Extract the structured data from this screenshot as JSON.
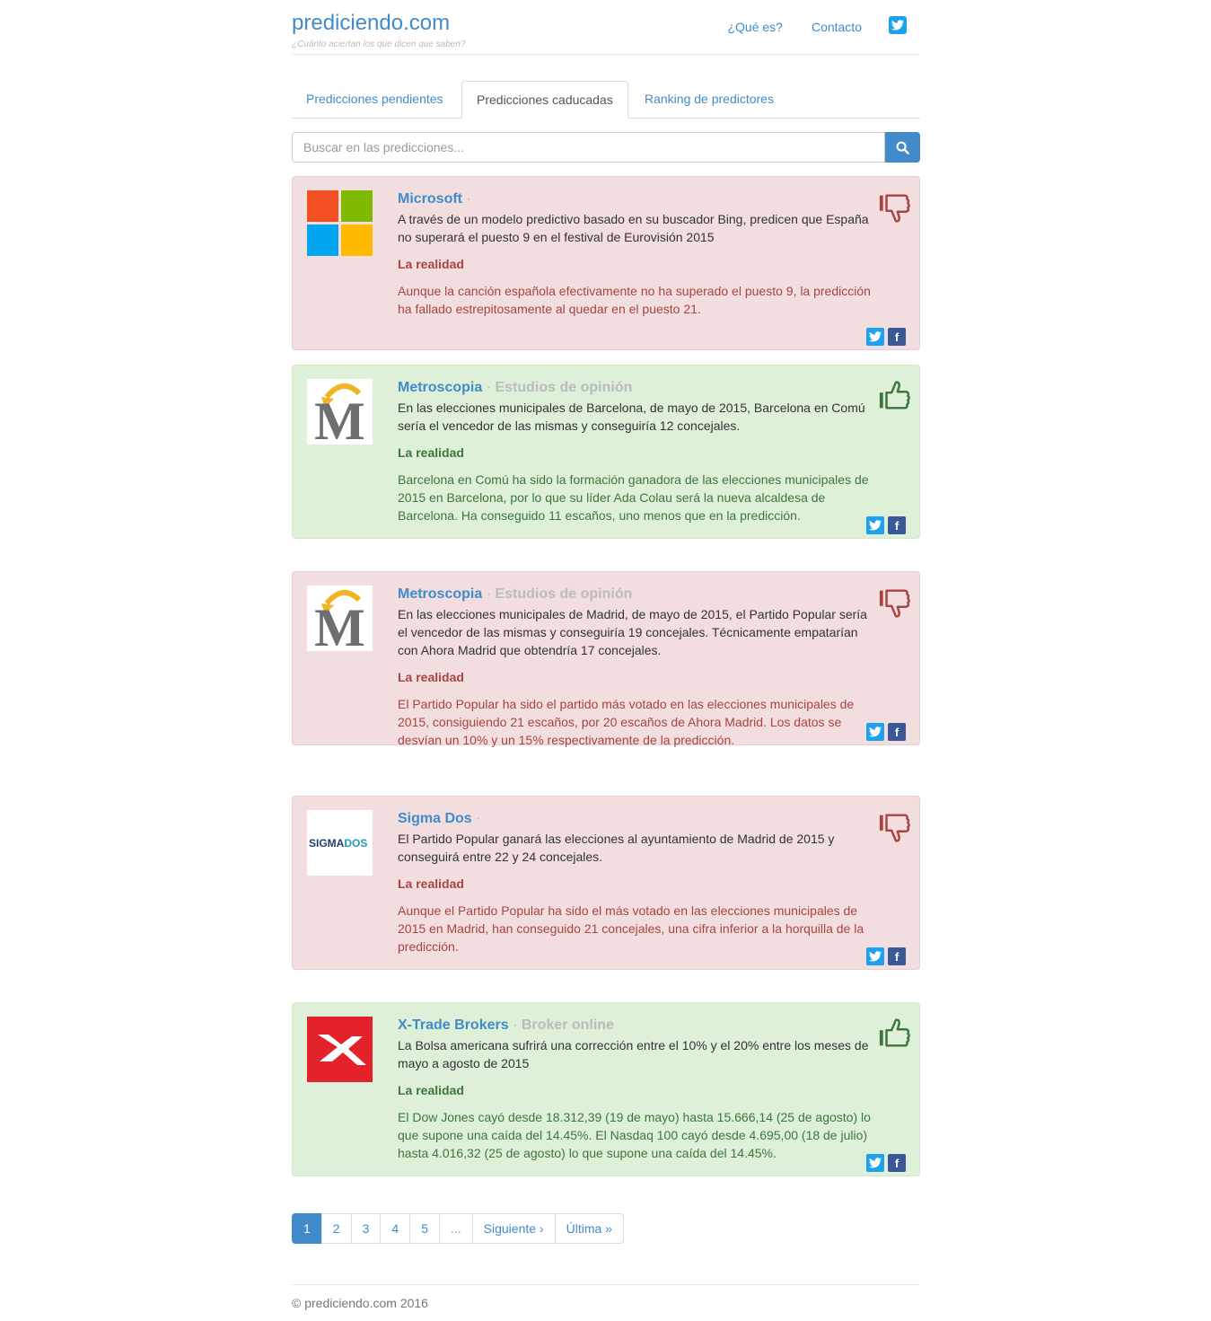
{
  "header": {
    "brand": "prediciendo.com",
    "tagline": "¿Cuánto aciertan los que dicen que saben?",
    "nav": [
      "¿Qué es?",
      "Contacto"
    ]
  },
  "tabs": [
    {
      "label": "Predicciones pendientes",
      "active": false
    },
    {
      "label": "Predicciones caducadas",
      "active": true
    },
    {
      "label": "Ranking de predictores",
      "active": false
    }
  ],
  "search": {
    "placeholder": "Buscar en las predicciones..."
  },
  "predictions": [
    {
      "status": "fail",
      "predictor": "Microsoft",
      "separator": "·",
      "category": "",
      "text": "A través de un modelo predictivo basado en su buscador Bing, predicen que España no superará el puesto 9 en el festival de Eurovisión 2015",
      "reality_label": "La realidad",
      "reality": "Aunque la canción española efectivamente no ha superado el puesto 9, la predicción ha fallado estrepitosamente al quedar en el puesto 21."
    },
    {
      "status": "ok",
      "predictor": "Metroscopia",
      "separator": "·",
      "category": "Estudios de opinión",
      "text": "En las elecciones municipales de Barcelona, de mayo de 2015, Barcelona en Comú sería el vencedor de las mismas y conseguiría 12 concejales.",
      "reality_label": "La realidad",
      "reality": "Barcelona en Comú ha sido la formación ganadora de las elecciones municipales de 2015 en Barcelona, por lo que su líder Ada Colau será la nueva alcaldesa de Barcelona. Ha conseguido 11 escaños, uno menos que en la predicción."
    },
    {
      "status": "fail",
      "predictor": "Metroscopia",
      "separator": "·",
      "category": "Estudios de opinión",
      "text": "En las elecciones municipales de Madrid, de mayo de 2015, el Partido Popular sería el vencedor de las mismas y conseguiría 19 concejales. Técnicamente empatarían con Ahora Madrid que obtendría 17 concejales.",
      "reality_label": "La realidad",
      "reality": "El Partido Popular ha sido el partido más votado en las elecciones municipales de 2015, consiguiendo 21 escaños, por 20 escaños de Ahora Madrid. Los datos se desvían un 10% y un 15% respectivamente de la predicción."
    },
    {
      "status": "fail",
      "predictor": "Sigma Dos",
      "separator": "·",
      "category": "",
      "text": "El Partido Popular ganará las elecciones al ayuntamiento de Madrid de 2015 y conseguirá entre 22 y 24 concejales.",
      "reality_label": "La realidad",
      "reality": "Aunque el Partido Popular ha sido el más votado en las elecciones municipales de 2015 en Madrid, han conseguido 21 concejales, una cifra inferior a la horquilla de la predicción."
    },
    {
      "status": "ok",
      "predictor": "X-Trade Brokers",
      "separator": "·",
      "category": "Broker online",
      "text": "La Bolsa americana sufrirá una corrección entre el 10% y el 20% entre los meses de mayo a agosto de 2015",
      "reality_label": "La realidad",
      "reality": "El Dow Jones cayó desde 18.312,39 (19 de mayo) hasta 15.666,14 (25 de agosto) lo que supone una caída del 14.45%. El Nasdaq 100 cayó desde 4.695,00 (18 de julio) hasta 4.016,32 (25 de agosto) lo que supone una caída del 14.45%."
    }
  ],
  "logos": {
    "metroscopia_letter": "M",
    "sigmados_a": "SIGMA",
    "sigmados_b": "DOS"
  },
  "share": {
    "facebook": "f"
  },
  "pagination": [
    "1",
    "2",
    "3",
    "4",
    "5",
    "...",
    "Siguiente ›",
    "Última »"
  ],
  "footer": "© prediciendo.com 2016",
  "colors": {
    "link": "#428bca",
    "fail_bg": "#f2dede",
    "ok_bg": "#dff0d8",
    "fail_text": "#a94442",
    "ok_text": "#3c763d"
  }
}
